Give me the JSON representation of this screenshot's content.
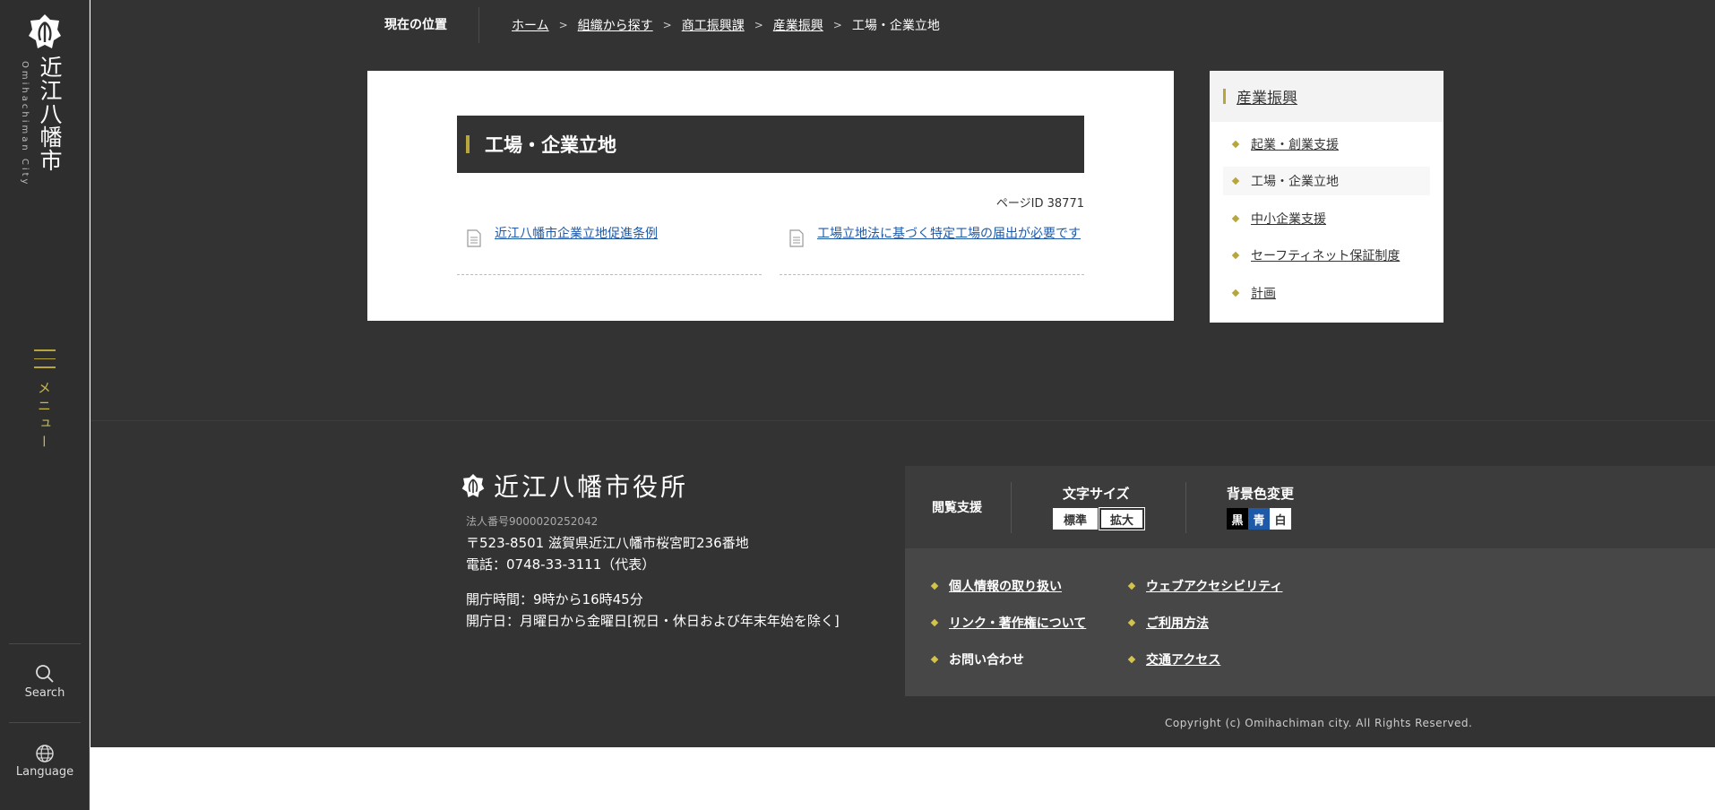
{
  "sidebar": {
    "logo_kanji": "近江八幡市",
    "logo_roman": "Omihachiman City",
    "menu_label": "メニュー",
    "search_label": "Search",
    "language_label": "Language"
  },
  "breadcrumb": {
    "title": "現在の位置",
    "items": [
      "ホーム",
      "組織から探す",
      "商工振興課",
      "産業振興"
    ],
    "current": "工場・企業立地",
    "separator": ">"
  },
  "content": {
    "heading": "工場・企業立地",
    "page_id": "ページID 38771",
    "links": [
      "近江八幡市企業立地促進条例",
      "工場立地法に基づく特定工場の届出が必要です"
    ]
  },
  "side_nav": {
    "heading": "産業振興",
    "items": [
      "起業・創業支援",
      "工場・企業立地",
      "中小企業支援",
      "セーフティネット保証制度",
      "計画"
    ],
    "current_index": 1
  },
  "footer": {
    "office_name": "近江八幡市役所",
    "corp_number": "法人番号9000020252042",
    "address": "〒523-8501 滋賀県近江八幡市桜宮町236番地",
    "phone": "電話：0748-33-3111（代表）",
    "hours": "開庁時間：9時から16時45分",
    "days": "開庁日：月曜日から金曜日[祝日・休日および年末年始を除く]",
    "support_label": "閲覧支援",
    "font_size_label": "文字サイズ",
    "font_size_options": [
      "標準",
      "拡大"
    ],
    "bg_color_label": "背景色変更",
    "bg_color_options": [
      "黒",
      "青",
      "白"
    ],
    "links": [
      "個人情報の取り扱い",
      "ウェブアクセシビリティ",
      "リンク・著作権について",
      "ご利用方法",
      "お問い合わせ",
      "交通アクセス"
    ],
    "copyright": "Copyright (c) Omihachiman city. All Rights Reserved."
  },
  "colors": {
    "accent": "#b8a63c",
    "dark_bg": "#333333",
    "link_blue": "#1f5aa8",
    "bg_black": "#000000",
    "bg_blue": "#1f5aa8",
    "bg_white": "#ffffff"
  }
}
